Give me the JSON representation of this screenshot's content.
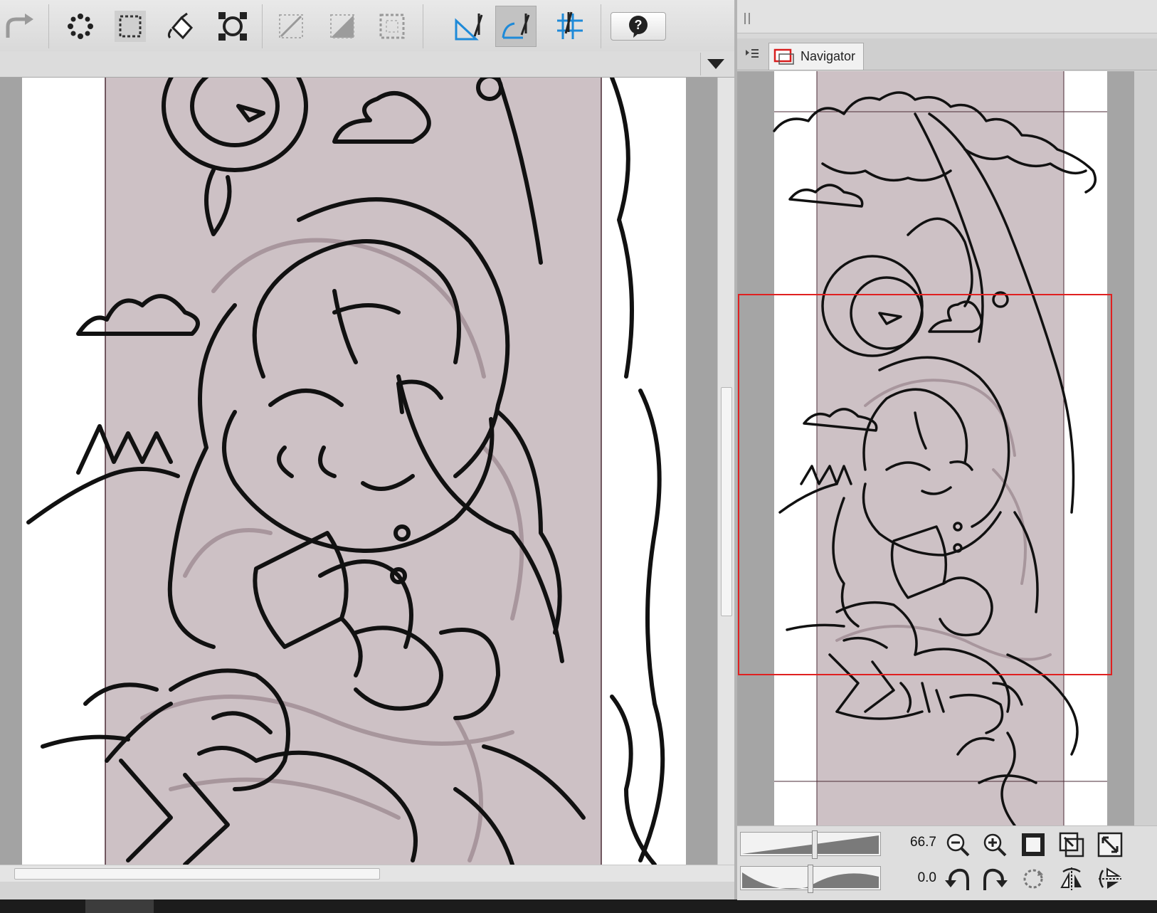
{
  "toolbar": {
    "icons": [
      "redo-icon",
      "transform-points-icon",
      "selection-icon",
      "fill-icon",
      "transform-icon",
      "guide-icon",
      "ruler-icon",
      "grid-icon",
      "ruler-snap-icon",
      "special-ruler-snap-icon",
      "grid-snap-icon",
      "help-icon"
    ]
  },
  "navigator": {
    "tab_label": "Navigator",
    "zoom_value": "66.7",
    "rotation_value": "0.0"
  },
  "colors": {
    "viewport_frame": "#e02020",
    "paper": "#ffffff",
    "tint": "#cdc1c5",
    "line": "#111111"
  }
}
